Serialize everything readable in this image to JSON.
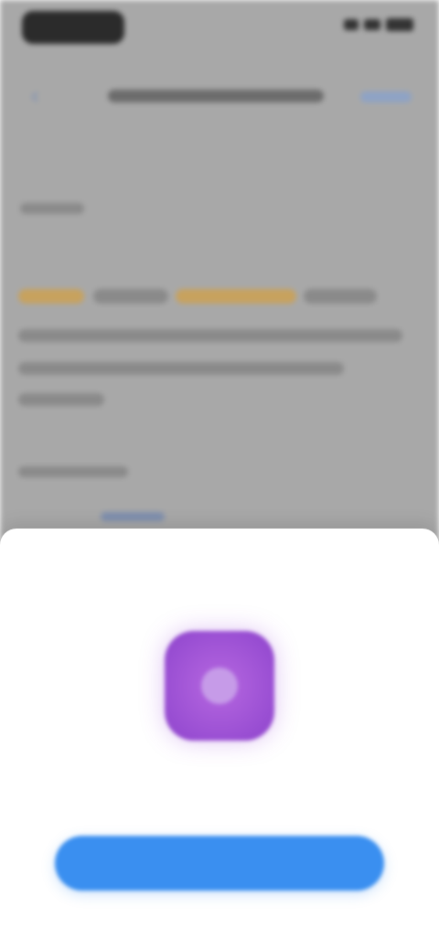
{
  "sheet": {
    "title": "",
    "description": "",
    "primary_button_label": ""
  },
  "app_icon": {
    "name": "app-icon",
    "color": "#9a4fd3"
  },
  "colors": {
    "accent": "#3a8ff0",
    "highlight": "#c7a25e"
  }
}
